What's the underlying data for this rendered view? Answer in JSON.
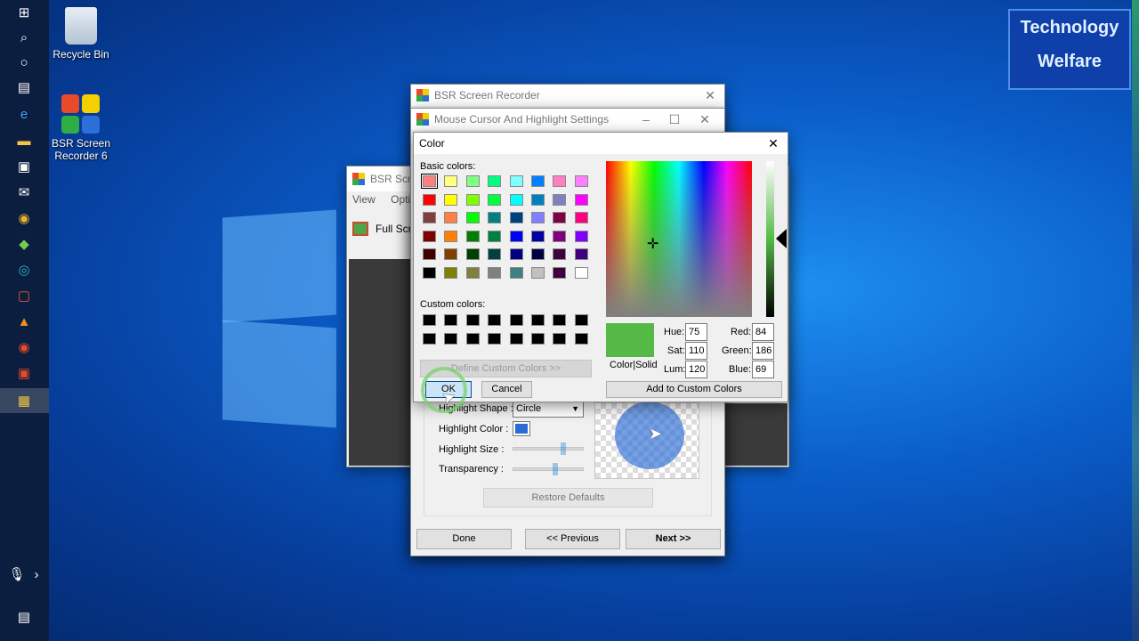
{
  "desktop": {
    "icons": [
      {
        "label": "Recycle Bin"
      },
      {
        "label": "BSR Screen Recorder 6"
      }
    ],
    "watermark": {
      "line1": "Technology",
      "line2": "Welfare"
    }
  },
  "bsr_main": {
    "title": "BSR Screen Recorder",
    "back_title": "BSR Scre",
    "menu": [
      "View",
      "Optic"
    ],
    "full_screen_label": "Full Scre"
  },
  "settings": {
    "title": "Mouse Cursor And Highlight Settings",
    "highlight_shape_label": "Highlight Shape",
    "highlight_shape_value": "Circle",
    "highlight_color_label": "Highlight Color",
    "highlight_size_label": "Highlight Size",
    "transparency_label": "Transparency",
    "restore_defaults": "Restore Defaults",
    "done": "Done",
    "previous": "<< Previous",
    "next": "Next >>",
    "highlight_color": "#2a6cd6"
  },
  "color_dialog": {
    "title": "Color",
    "basic_colors_label": "Basic colors:",
    "custom_colors_label": "Custom colors:",
    "define_custom": "Define Custom Colors >>",
    "ok": "OK",
    "cancel": "Cancel",
    "add_custom": "Add to Custom Colors",
    "color_solid": "Color|Solid",
    "hue_label": "Hue:",
    "hue": "75",
    "sat_label": "Sat:",
    "sat": "110",
    "lum_label": "Lum:",
    "lum": "120",
    "red_label": "Red:",
    "red": "84",
    "green_label": "Green:",
    "green": "186",
    "blue_label": "Blue:",
    "blue": "69",
    "current_color": "#54ba45",
    "basic_colors": [
      [
        "#ff8080",
        "#ffff80",
        "#80ff80",
        "#00ff80",
        "#80ffff",
        "#0080ff",
        "#ff80c0",
        "#ff80ff"
      ],
      [
        "#ff0000",
        "#ffff00",
        "#80ff00",
        "#00ff40",
        "#00ffff",
        "#0080c0",
        "#8080c0",
        "#ff00ff"
      ],
      [
        "#804040",
        "#ff8040",
        "#00ff00",
        "#008080",
        "#004080",
        "#8080ff",
        "#800040",
        "#ff0080"
      ],
      [
        "#800000",
        "#ff8000",
        "#008000",
        "#008040",
        "#0000ff",
        "#0000a0",
        "#800080",
        "#8000ff"
      ],
      [
        "#400000",
        "#804000",
        "#004000",
        "#004040",
        "#000080",
        "#000040",
        "#400040",
        "#400080"
      ],
      [
        "#000000",
        "#808000",
        "#808040",
        "#808080",
        "#408080",
        "#c0c0c0",
        "#400040",
        "#ffffff"
      ]
    ]
  }
}
